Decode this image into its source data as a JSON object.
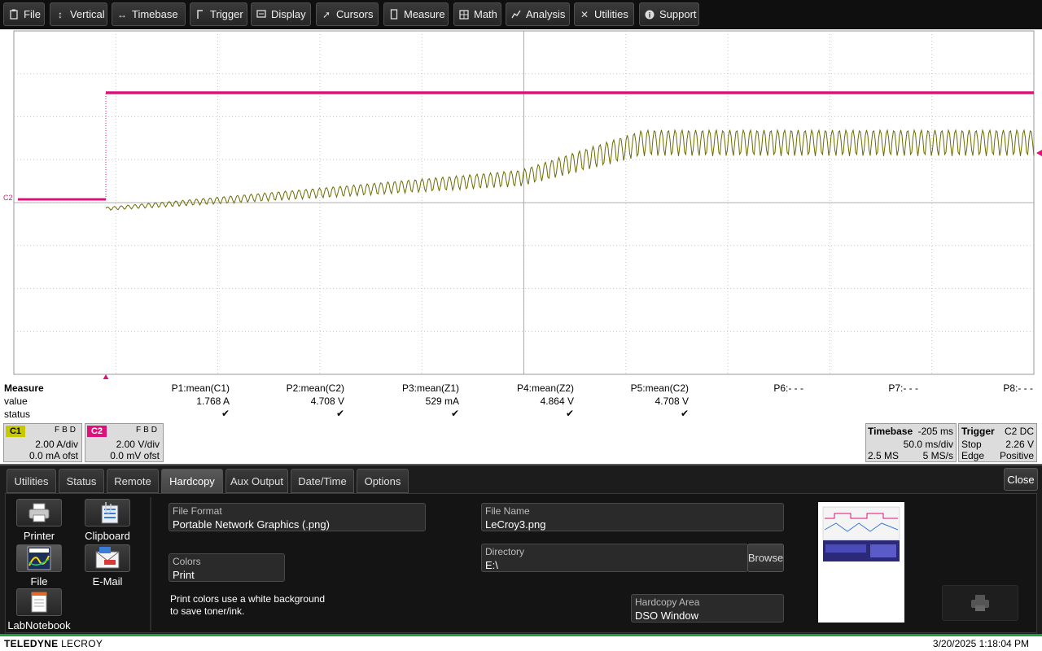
{
  "menu": [
    {
      "label": "File",
      "icon": "file-icon"
    },
    {
      "label": "Vertical",
      "icon": "vertical-icon"
    },
    {
      "label": "Timebase",
      "icon": "timebase-icon"
    },
    {
      "label": "Trigger",
      "icon": "trigger-icon"
    },
    {
      "label": "Display",
      "icon": "display-icon"
    },
    {
      "label": "Cursors",
      "icon": "cursors-icon"
    },
    {
      "label": "Measure",
      "icon": "measure-icon"
    },
    {
      "label": "Math",
      "icon": "math-icon"
    },
    {
      "label": "Analysis",
      "icon": "analysis-icon"
    },
    {
      "label": "Utilities",
      "icon": "utilities-icon"
    },
    {
      "label": "Support",
      "icon": "support-icon"
    }
  ],
  "grid": {
    "c2_label": "C2",
    "colors": {
      "c1": "#6b6b00",
      "c2": "#e0107a",
      "grid": "#9a9a9a",
      "trigger": "#e0107a"
    }
  },
  "measure": {
    "title": "Measure",
    "row_value": "value",
    "row_status": "status",
    "params": [
      {
        "name": "P1:mean(C1)",
        "value": "1.768 A",
        "status": "✔"
      },
      {
        "name": "P2:mean(C2)",
        "value": "4.708 V",
        "status": "✔"
      },
      {
        "name": "P3:mean(Z1)",
        "value": "529 mA",
        "status": "✔"
      },
      {
        "name": "P4:mean(Z2)",
        "value": "4.864 V",
        "status": "✔"
      },
      {
        "name": "P5:mean(C2)",
        "value": "4.708 V",
        "status": "✔"
      },
      {
        "name": "P6:- - -",
        "value": "",
        "status": ""
      },
      {
        "name": "P7:- - -",
        "value": "",
        "status": ""
      },
      {
        "name": "P8:- - -",
        "value": "",
        "status": ""
      }
    ]
  },
  "channels": [
    {
      "tag": "C1",
      "flags": "FBD",
      "scale": "2.00 A/div",
      "offset": "0.0 mA ofst",
      "color": "#c8c800"
    },
    {
      "tag": "C2",
      "flags": "FBD",
      "scale": "2.00 V/div",
      "offset": "0.0 mV ofst",
      "color": "#e0107a"
    }
  ],
  "timebase": {
    "title": "Timebase",
    "delay": "-205 ms",
    "scale": "50.0 ms/div",
    "samples": "2.5 MS",
    "rate": "5 MS/s"
  },
  "trigger": {
    "title": "Trigger",
    "source": "C2 DC",
    "mode": "Stop",
    "level": "2.26 V",
    "type": "Edge",
    "slope": "Positive"
  },
  "dialog": {
    "tabs": [
      "Utilities",
      "Status",
      "Remote",
      "Hardcopy",
      "Aux Output",
      "Date/Time",
      "Options"
    ],
    "active_tab": "Hardcopy",
    "close_label": "Close",
    "devices": [
      {
        "label": "Printer",
        "icon": "printer-icon"
      },
      {
        "label": "Clipboard",
        "icon": "clipboard-icon"
      },
      {
        "label": "File",
        "icon": "file-picture-icon"
      },
      {
        "label": "E-Mail",
        "icon": "email-icon"
      },
      {
        "label": "LabNotebook",
        "icon": "notebook-icon"
      }
    ],
    "file_format": {
      "title": "File Format",
      "value": "Portable Network Graphics (.png)"
    },
    "colors": {
      "title": "Colors",
      "value": "Print"
    },
    "note": "Print colors use a white background to save toner/ink.",
    "file_name": {
      "title": "File Name",
      "value": "LeCroy3.png"
    },
    "directory": {
      "title": "Directory",
      "value": "E:\\"
    },
    "browse_label": "Browse",
    "hardcopy_area": {
      "title": "Hardcopy Area",
      "value": "DSO Window"
    }
  },
  "footer": {
    "brand": "TELEDYNE",
    "brand2": "LECROY",
    "datetime": "3/20/2025 1:18:04 PM"
  }
}
